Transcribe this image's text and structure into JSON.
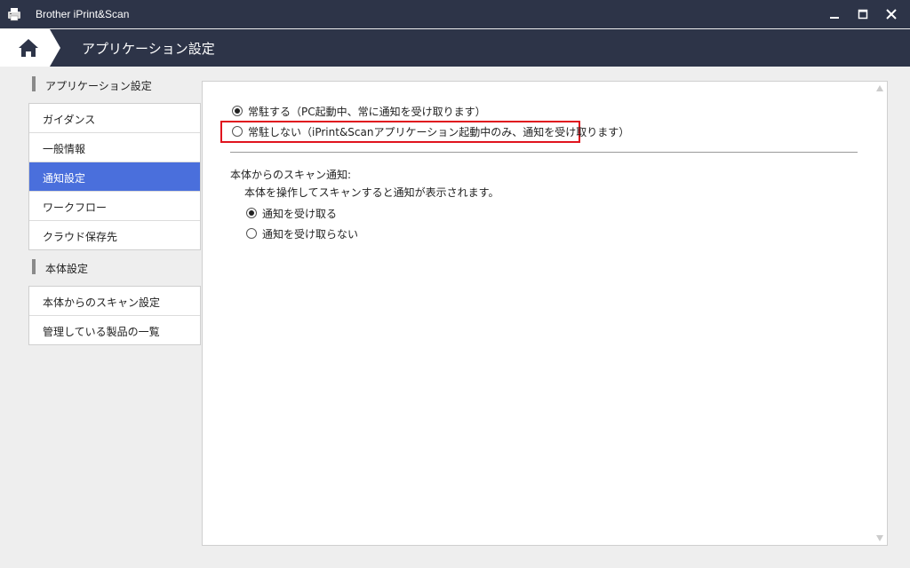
{
  "window": {
    "title": "Brother iPrint&Scan",
    "app_icon": "printer-icon",
    "controls": [
      "minimize-icon",
      "maximize-icon",
      "close-icon"
    ]
  },
  "navbar": {
    "home_icon": "home-icon",
    "breadcrumb": "アプリケーション設定"
  },
  "sidebar": {
    "app_section": "アプリケーション設定",
    "app_items": [
      {
        "label": "ガイダンス",
        "active": false
      },
      {
        "label": "一般情報",
        "active": false
      },
      {
        "label": "通知設定",
        "active": true
      },
      {
        "label": "ワークフロー",
        "active": false
      },
      {
        "label": "クラウド保存先",
        "active": false
      }
    ],
    "device_section": "本体設定",
    "device_items": [
      {
        "label": "本体からのスキャン設定"
      },
      {
        "label": "管理している製品の一覧"
      }
    ]
  },
  "content": {
    "resident_options": [
      {
        "label": "常駐する（PC起動中、常に通知を受け取ります）",
        "selected": true
      },
      {
        "label": "常駐しない（iPrint&Scanアプリケーション起動中のみ、通知を受け取ります）",
        "selected": false
      }
    ],
    "scan_section_title": "本体からのスキャン通知:",
    "scan_section_desc": "本体を操作してスキャンすると通知が表示されます。",
    "scan_options": [
      {
        "label": "通知を受け取る",
        "selected": true
      },
      {
        "label": "通知を受け取らない",
        "selected": false
      }
    ]
  },
  "colors": {
    "titlebar": "#2d3448",
    "active_item": "#4a6fdc",
    "highlight": "#e0141e"
  }
}
